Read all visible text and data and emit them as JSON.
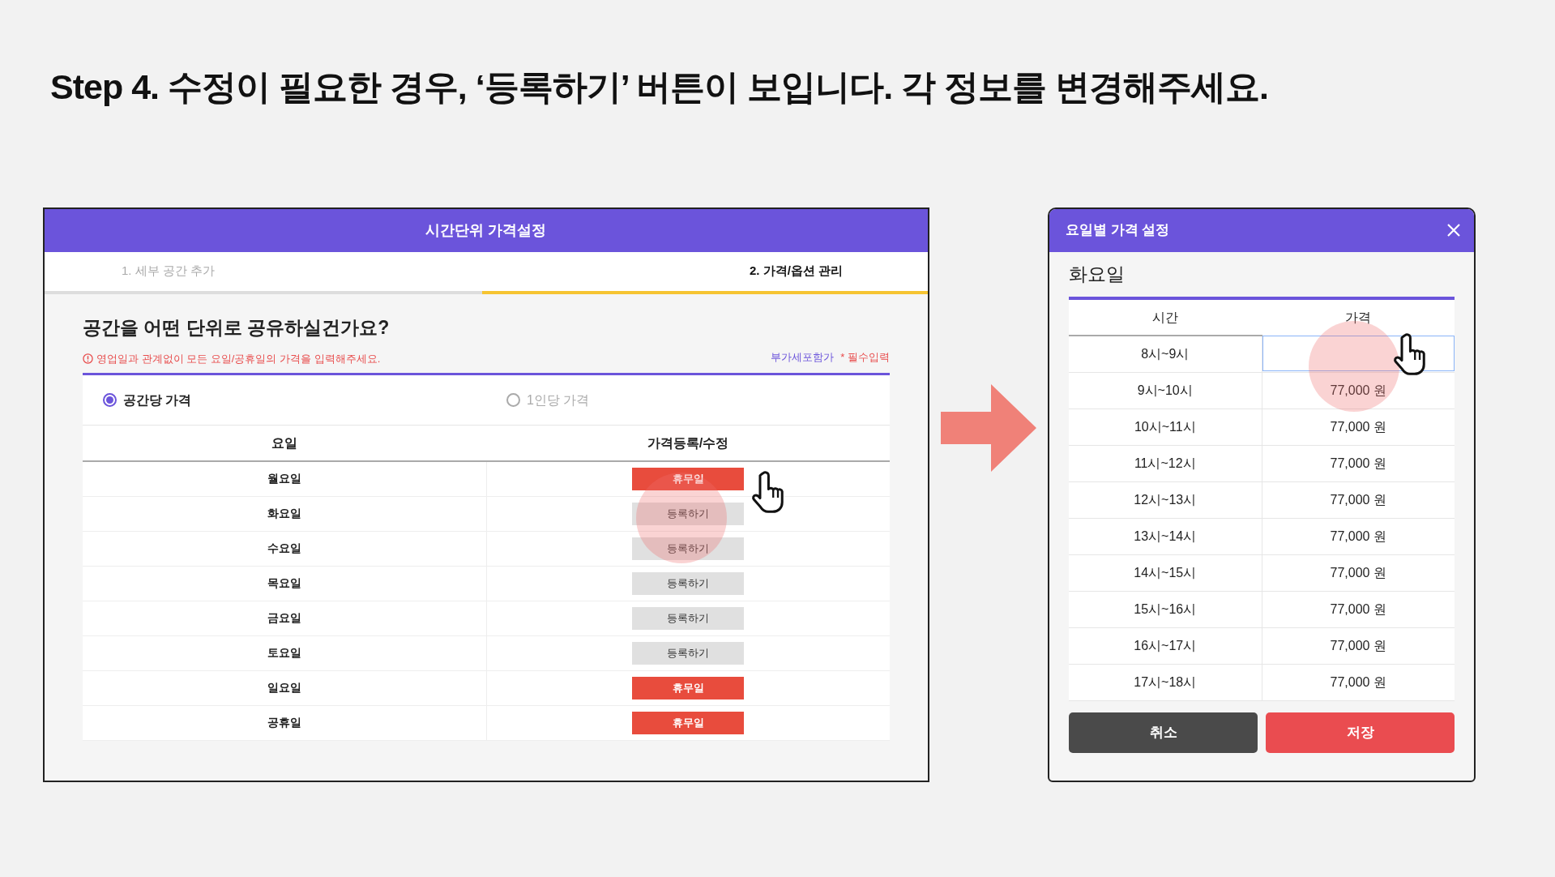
{
  "slide_title": "Step 4. 수정이 필요한 경우, ‘등록하기’ 버튼이 보입니다. 각 정보를 변경해주세요.",
  "price_window": {
    "title": "시간단위 가격설정",
    "tabs": [
      {
        "label": "1. 세부 공간 추가",
        "selected": false
      },
      {
        "label": "2. 가격/옵션 관리",
        "selected": true
      }
    ],
    "question": "공간을 어떤 단위로 공유하실건가요?",
    "notice": "영업일과 관계없이 모든 요일/공휴일의 가격을 입력해주세요.",
    "vat_label": "부가세포함가",
    "required_label": "* 필수입력",
    "options": [
      {
        "label": "공간당 가격",
        "selected": true
      },
      {
        "label": "1인당 가격",
        "selected": false
      }
    ],
    "columns": [
      "요일",
      "가격등록/수정"
    ],
    "rows": [
      {
        "day": "월요일",
        "kind": "holiday",
        "action": "휴무일"
      },
      {
        "day": "화요일",
        "kind": "register",
        "action": "등록하기"
      },
      {
        "day": "수요일",
        "kind": "register",
        "action": "등록하기"
      },
      {
        "day": "목요일",
        "kind": "register",
        "action": "등록하기"
      },
      {
        "day": "금요일",
        "kind": "register",
        "action": "등록하기"
      },
      {
        "day": "토요일",
        "kind": "register",
        "action": "등록하기"
      },
      {
        "day": "일요일",
        "kind": "holiday",
        "action": "휴무일"
      },
      {
        "day": "공휴일",
        "kind": "holiday",
        "action": "휴무일"
      }
    ]
  },
  "day_dialog": {
    "title": "요일별 가격 설정",
    "day": "화요일",
    "columns": [
      "시간",
      "가격"
    ],
    "rows": [
      {
        "time": "8시~9시",
        "kind": "input"
      },
      {
        "time": "9시~10시",
        "kind": "text",
        "price": "77,000 원"
      },
      {
        "time": "10시~11시",
        "kind": "text",
        "price": "77,000 원"
      },
      {
        "time": "11시~12시",
        "kind": "text",
        "price": "77,000 원"
      },
      {
        "time": "12시~13시",
        "kind": "text",
        "price": "77,000 원"
      },
      {
        "time": "13시~14시",
        "kind": "text",
        "price": "77,000 원"
      },
      {
        "time": "14시~15시",
        "kind": "text",
        "price": "77,000 원"
      },
      {
        "time": "15시~16시",
        "kind": "text",
        "price": "77,000 원"
      },
      {
        "time": "16시~17시",
        "kind": "text",
        "price": "77,000 원"
      },
      {
        "time": "17시~18시",
        "kind": "text",
        "price": "77,000 원"
      }
    ],
    "buttons": [
      {
        "label": "취소",
        "kind": "cancel"
      },
      {
        "label": "저장",
        "kind": "save"
      }
    ]
  }
}
